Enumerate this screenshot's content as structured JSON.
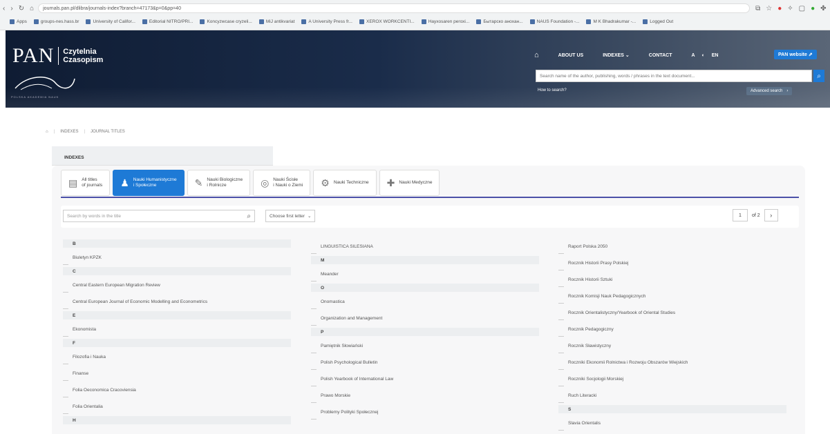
{
  "browser": {
    "url": "journals.pan.pl/dlibra/journals-index?branch=47173&p=0&pp=40",
    "bookmarks": [
      "Apps",
      "groups-nes.hass.br",
      "University of Califor...",
      "Editorial NITRO/PRI...",
      "Koncyzwcase cryzeli...",
      "MiJ antikvariat",
      "A University Press fr...",
      "XEROX WORKCENTI...",
      "Hayxosaren peroxi...",
      "Бытарско aнoxaн...",
      "NAUS Foundation -...",
      "M K Bhadrakumar -...",
      "Logged Out"
    ]
  },
  "header": {
    "logo_pan": "PAN",
    "logo_line1": "Czytelnia",
    "logo_line2": "Czasopism",
    "logo_tagline": "POLSKA AKADEMIA NAUK",
    "nav": [
      "ABOUT US",
      "INDEXES ⌄",
      "CONTACT"
    ],
    "lang": [
      "A",
      "◐",
      "EN"
    ],
    "pan_website": "PAN website ⇗",
    "search_placeholder": "Search name of the author, publishing, words / phrases in the text document...",
    "how_to_search": "How to search?",
    "advanced_search": "Advanced search",
    "advanced_search_arrow": "›"
  },
  "breadcrumb": [
    "INDEXES",
    "JOURNAL TITLES"
  ],
  "indexes_title": "INDEXES",
  "tabs": [
    {
      "line1": "All titles",
      "line2": "of journals",
      "icon": "▤"
    },
    {
      "line1": "Nauki Humanistyczne",
      "line2": "i Społeczne",
      "icon": "♟"
    },
    {
      "line1": "Nauki Biologiczne",
      "line2": "i Rolnicze",
      "icon": "✎"
    },
    {
      "line1": "Nauki Ścisłe",
      "line2": "i Nauki o Ziemi",
      "icon": "◎"
    },
    {
      "line1": "Nauki Techniczne",
      "line2": "",
      "icon": "⚙"
    },
    {
      "line1": "Nauki Medyczne",
      "line2": "",
      "icon": "✚"
    }
  ],
  "filter": {
    "search_placeholder": "Search by words in the title",
    "letter_label": "Choose first letter",
    "page": "1",
    "of_pages": "of 2",
    "next": "›"
  },
  "columns": [
    [
      {
        "t": "letter",
        "v": "B"
      },
      {
        "t": "title",
        "v": "Biuletyn KPZK"
      },
      {
        "t": "letter",
        "v": "C"
      },
      {
        "t": "title",
        "v": "Central Eastern European Migration Review"
      },
      {
        "t": "title",
        "v": "Central European Journal of Economic Modelling and Econometrics"
      },
      {
        "t": "letter",
        "v": "E"
      },
      {
        "t": "title",
        "v": "Ekonomista"
      },
      {
        "t": "letter",
        "v": "F"
      },
      {
        "t": "title",
        "v": "Filozofia i Nauka"
      },
      {
        "t": "title",
        "v": "Finanse"
      },
      {
        "t": "title",
        "v": "Folia Oeconomica Cracoviensia"
      },
      {
        "t": "title",
        "v": "Folia Orientalia"
      },
      {
        "t": "letter",
        "v": "H"
      }
    ],
    [
      {
        "t": "title",
        "v": "LINGUISTICA SILESIANA"
      },
      {
        "t": "letter",
        "v": "M"
      },
      {
        "t": "title",
        "v": "Meander"
      },
      {
        "t": "letter",
        "v": "O"
      },
      {
        "t": "title",
        "v": "Onomastica"
      },
      {
        "t": "title",
        "v": "Organization and Management"
      },
      {
        "t": "letter",
        "v": "P"
      },
      {
        "t": "title",
        "v": "Pamiętnik Słowiański"
      },
      {
        "t": "title",
        "v": "Polish Psychological Bulletin"
      },
      {
        "t": "title",
        "v": "Polish Yearbook of International Law"
      },
      {
        "t": "title",
        "v": "Prawo Morskie"
      },
      {
        "t": "title",
        "v": "Problemy Polityki Społecznej"
      }
    ],
    [
      {
        "t": "title",
        "v": "Raport Polska 2050"
      },
      {
        "t": "title",
        "v": "Rocznik Historii Prasy Polskiej"
      },
      {
        "t": "title",
        "v": "Rocznik Historii Sztuki"
      },
      {
        "t": "title",
        "v": "Rocznik Komisji Nauk Pedagogicznych"
      },
      {
        "t": "title",
        "v": "Rocznik Orientalistyczny/Yearbook of Oriental Studies"
      },
      {
        "t": "title",
        "v": "Rocznik Pedagogiczny"
      },
      {
        "t": "title",
        "v": "Rocznik Sławistyczny"
      },
      {
        "t": "title",
        "v": "Roczniki Ekonomii Rolnictwa i Rozwoju Obszarów Wiejskich"
      },
      {
        "t": "title",
        "v": "Roczniki Socjologii Morskiej"
      },
      {
        "t": "title",
        "v": "Ruch Literacki"
      },
      {
        "t": "letter",
        "v": "S"
      },
      {
        "t": "title",
        "v": "Slavia Orientalis"
      }
    ]
  ]
}
